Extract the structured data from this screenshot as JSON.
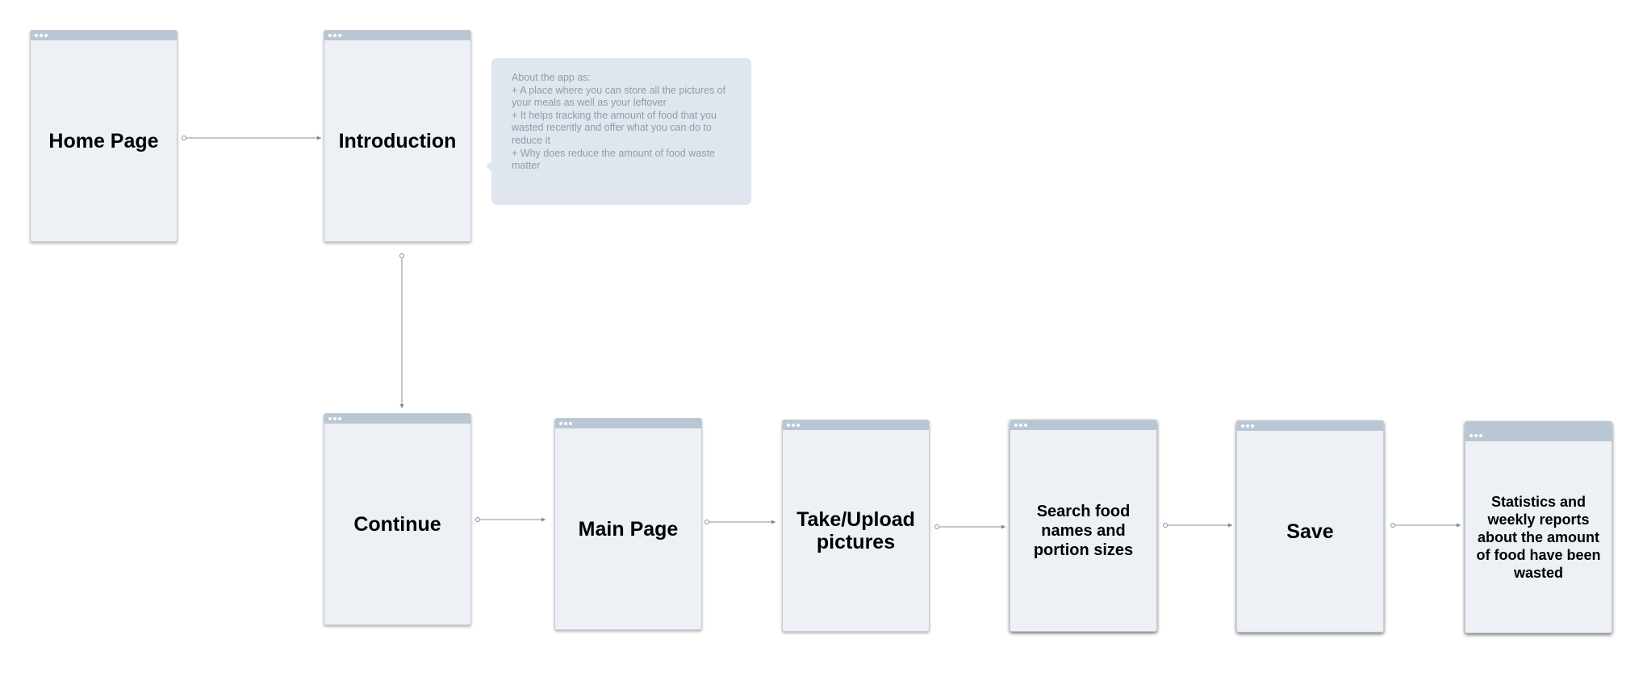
{
  "screens": {
    "home": "Home Page",
    "introduction": "Introduction",
    "continue": "Continue",
    "main": "Main Page",
    "take_upload": "Take/Upload pictures",
    "search": "Search food names and portion sizes",
    "save": "Save",
    "statistics": "Statistics and weekly reports about the amount of food have been wasted"
  },
  "note": {
    "lines": [
      "About the app as:",
      "+ A place where you can store all the pictures of your meals as well as your leftover",
      "+ It helps tracking the amount of food that you wasted recently and offer what you can do to reduce it",
      "+ Why does reduce the amount of food waste matter"
    ]
  },
  "colors": {
    "screen_fill": "#edf1f6",
    "titlebar": "#b9c6d3",
    "note_fill": "#dfe6ee",
    "note_text": "#8f9dab",
    "connector": "#8a9096"
  }
}
